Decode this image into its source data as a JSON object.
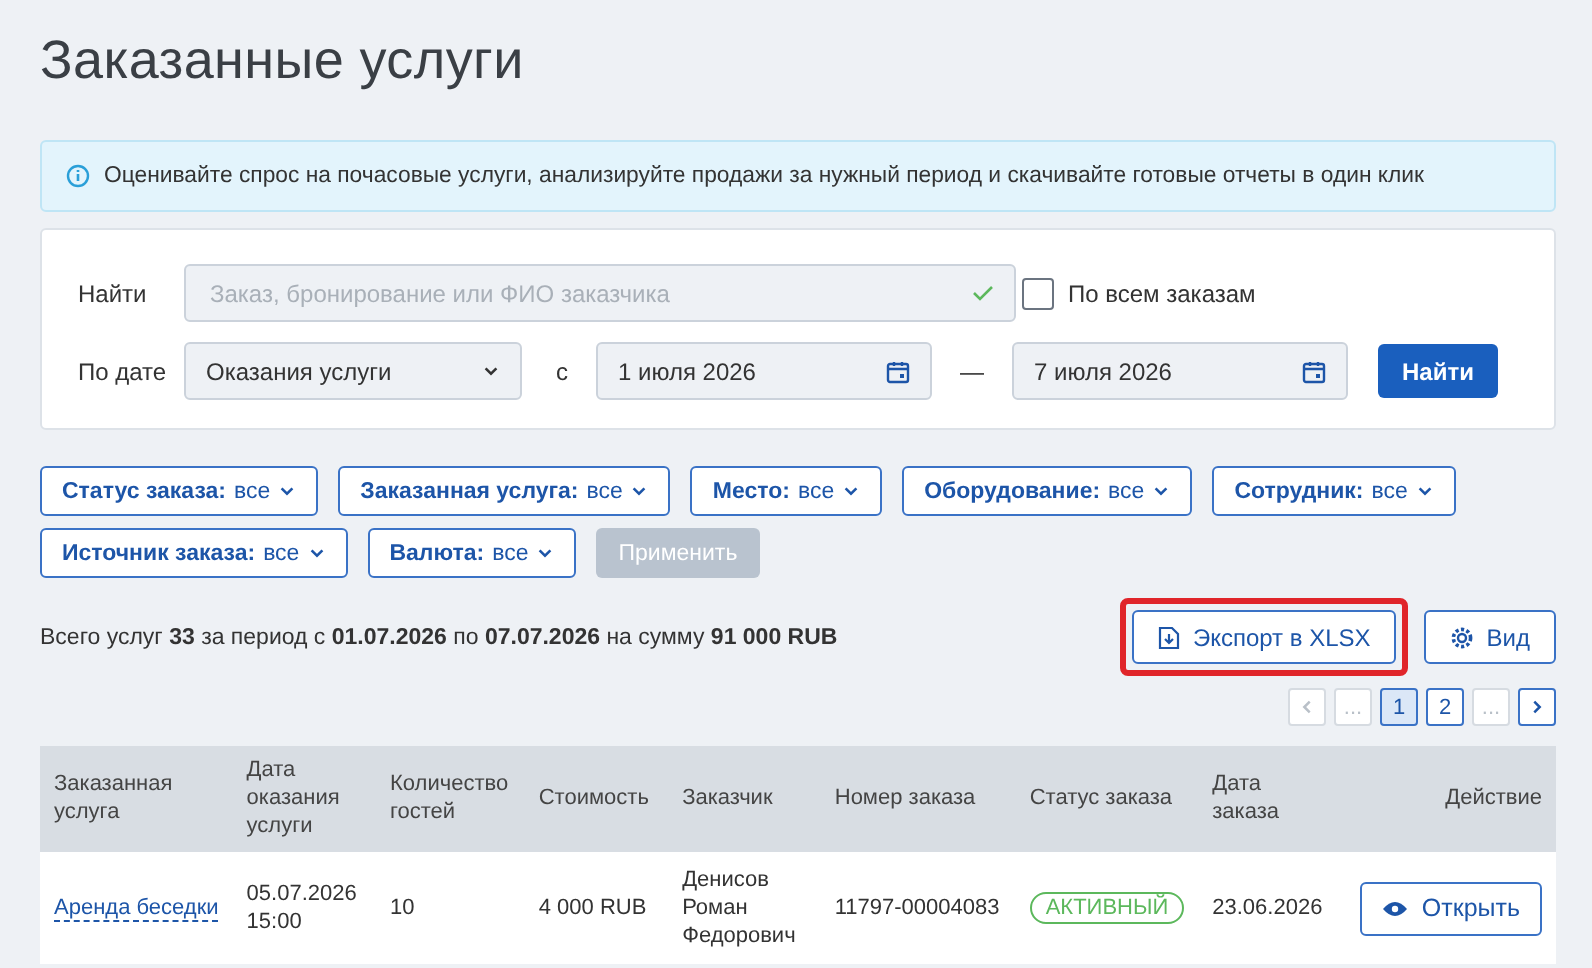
{
  "title": "Заказанные услуги",
  "info": "Оценивайте спрос на почасовые услуги, анализируйте продажи за нужный период и скачивайте готовые отчеты в один клик",
  "search": {
    "label": "Найти",
    "placeholder": "Заказ, бронирование или ФИО заказчика",
    "valid": true
  },
  "all_orders": {
    "label": "По всем заказам",
    "checked": false
  },
  "date_filter": {
    "label": "По дате",
    "select": "Оказания услуги",
    "from_label": "с",
    "from": "1 июля 2026",
    "separator": "—",
    "to": "7 июля 2026"
  },
  "find_button": "Найти",
  "filters": [
    {
      "name": "Статус заказа:",
      "value": "все"
    },
    {
      "name": "Заказанная услуга:",
      "value": "все"
    },
    {
      "name": "Место:",
      "value": "все"
    },
    {
      "name": "Оборудование:",
      "value": "все"
    },
    {
      "name": "Сотрудник:",
      "value": "все"
    },
    {
      "name": "Источник заказа:",
      "value": "все"
    },
    {
      "name": "Валюта:",
      "value": "все"
    }
  ],
  "apply_button": {
    "label": "Применить",
    "disabled": true
  },
  "summary": "Всего услуг **33** за период с **01.07.2026** по **07.07.2026** на сумму **91 000 RUB**",
  "export_button": {
    "label": "Экспорт в XLSX",
    "highlighted": true
  },
  "view_button": "Вид",
  "pagination": [
    {
      "kind": "prev",
      "disabled": true,
      "selected": false
    },
    {
      "kind": "page",
      "label": "...",
      "disabled": true,
      "selected": false
    },
    {
      "kind": "page",
      "label": "1",
      "disabled": false,
      "selected": true
    },
    {
      "kind": "page",
      "label": "2",
      "disabled": false,
      "selected": false
    },
    {
      "kind": "page",
      "label": "...",
      "disabled": true,
      "selected": false
    },
    {
      "kind": "next",
      "disabled": false,
      "selected": false
    }
  ],
  "table": {
    "columns": [
      "Заказанная услуга",
      "Дата оказания услуги",
      "Количество гостей",
      "Стоимость",
      "Заказчик",
      "Номер заказа",
      "Статус заказа",
      "Дата заказа",
      "Действие"
    ],
    "rows": [
      {
        "service": "Аренда беседки",
        "date": "05.07.2026 15:00",
        "guests": "10",
        "cost": "4 000 RUB",
        "customer": "Денисов Роман Федорович",
        "order_number": "11797-00004083",
        "status": "АКТИВНЫЙ",
        "color": "#5cb85c",
        "order_date": "23.06.2026",
        "action": "Открыть"
      }
    ]
  }
}
